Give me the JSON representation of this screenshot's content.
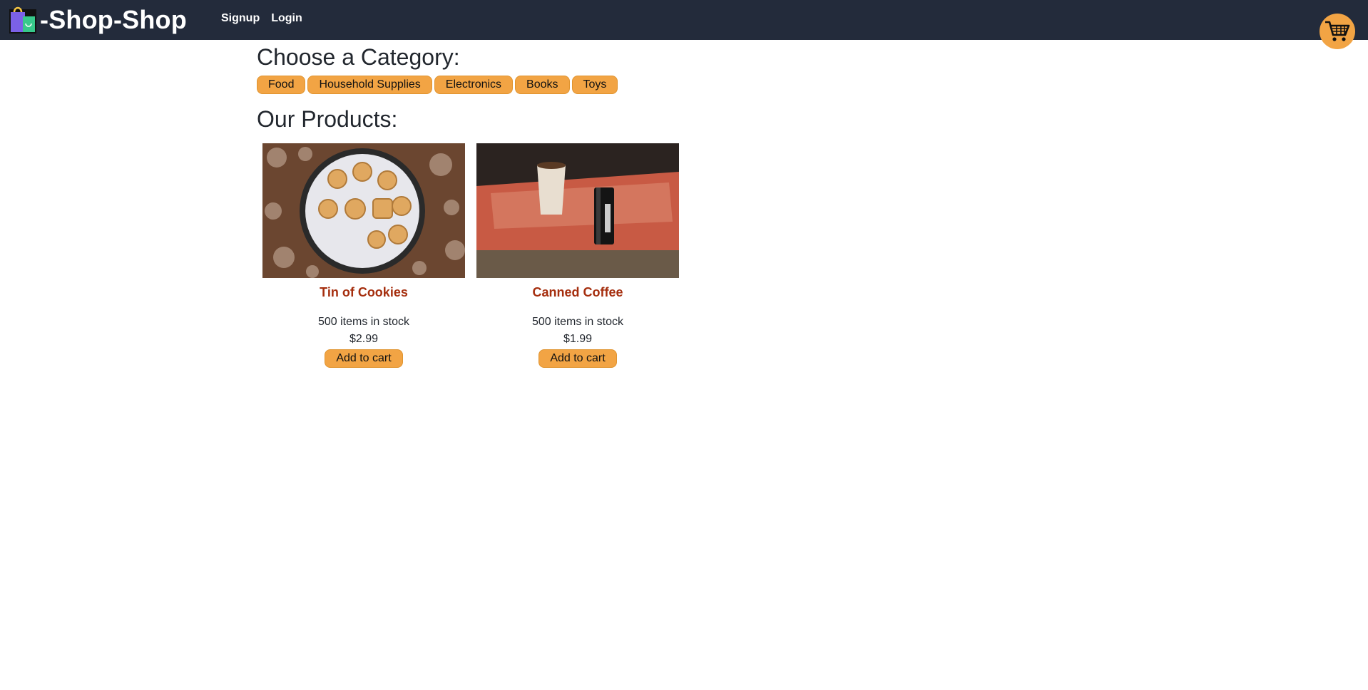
{
  "header": {
    "brand": "-Shop-Shop",
    "links": [
      "Signup",
      "Login"
    ],
    "cart_icon": "shopping-cart-icon"
  },
  "categories": {
    "title": "Choose a Category:",
    "items": [
      "Food",
      "Household Supplies",
      "Electronics",
      "Books",
      "Toys"
    ]
  },
  "products": {
    "title": "Our Products:",
    "items": [
      {
        "name": "Tin of Cookies",
        "stock": "500 items in stock",
        "price": "$2.99",
        "button": "Add to cart"
      },
      {
        "name": "Canned Coffee",
        "stock": "500 items in stock",
        "price": "$1.99",
        "button": "Add to cart"
      }
    ]
  },
  "colors": {
    "navbar": "#232b3b",
    "accent": "#f2a444",
    "product_title": "#a52e0e"
  }
}
